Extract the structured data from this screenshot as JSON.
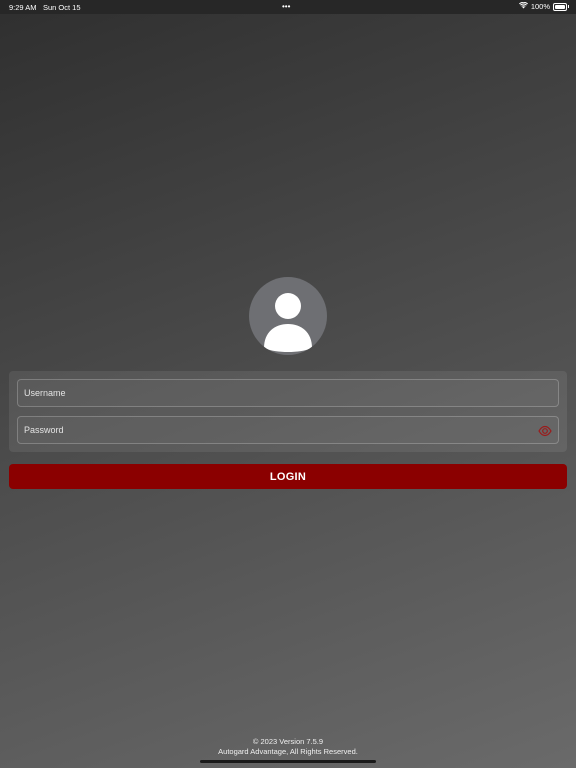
{
  "status_bar": {
    "time": "9:29 AM",
    "date": "Sun Oct 15",
    "multitask_dots": "•••",
    "battery_text": "100%",
    "battery_level": 1.0,
    "wifi_icon": "wifi-icon",
    "battery_icon": "battery-icon"
  },
  "avatar": {
    "icon": "person-icon"
  },
  "login_form": {
    "username_placeholder": "Username",
    "username_value": "",
    "password_placeholder": "Password",
    "password_value": "",
    "toggle_icon": "eye-icon"
  },
  "login_button": {
    "label": "LOGIN"
  },
  "footer": {
    "copyright": "© 2023 Version 7.5.9",
    "rights": "Autogard Advantage, All Rights Reserved."
  },
  "colors": {
    "accent": "#8b0000",
    "eye_icon": "#9b1b1b",
    "avatar_bg": "#6e6f73",
    "status_bar_bg": "#272727"
  }
}
